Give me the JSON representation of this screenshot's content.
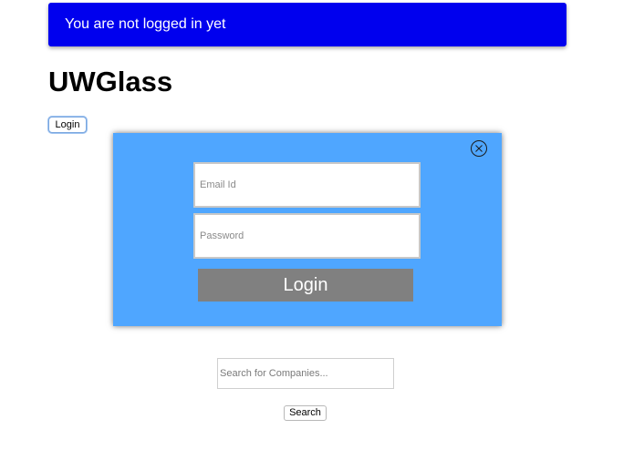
{
  "banner": {
    "message": "You are not logged in yet",
    "color": "#0000ee"
  },
  "header": {
    "title": "UWGlass"
  },
  "nav": {
    "login_button_label": "Login"
  },
  "login_modal": {
    "background_color": "#4fa6ff",
    "close_icon": "close-icon",
    "email_placeholder": "Email Id",
    "password_placeholder": "Password",
    "submit_label": "Login",
    "submit_color": "#808080"
  },
  "search": {
    "placeholder": "Search for Companies...",
    "button_label": "Search"
  }
}
